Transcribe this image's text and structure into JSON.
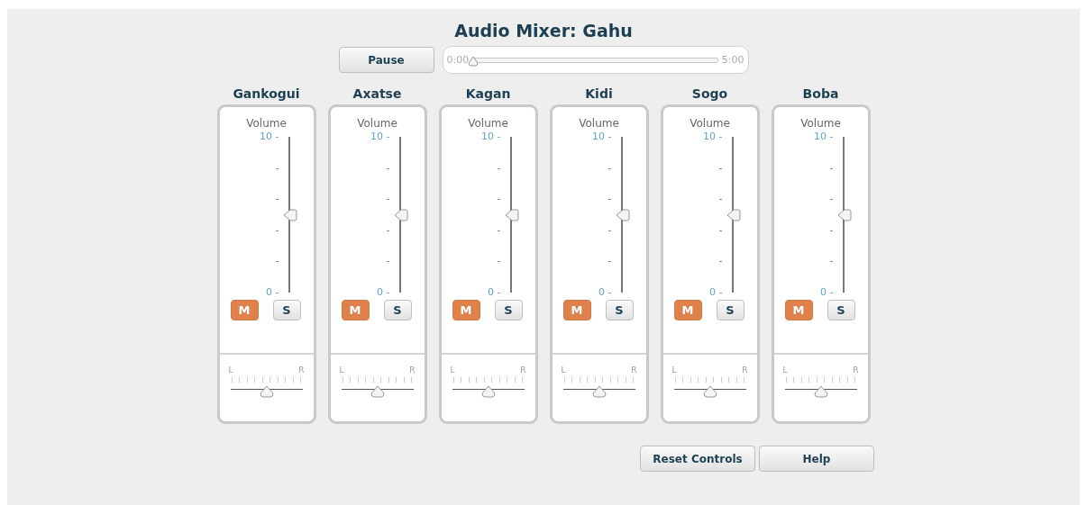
{
  "title": "Audio Mixer: Gahu",
  "transport": {
    "button": "Pause",
    "start": "0:00",
    "end": "5:00",
    "level": 0
  },
  "channels": [
    {
      "name": "Gankogui",
      "volume_label": "Volume",
      "scale": [
        "10 -",
        "-",
        "-",
        "-",
        "-",
        "0 -"
      ],
      "level": 0.5,
      "mute": {
        "label": "M",
        "on": true
      },
      "solo": {
        "label": "S",
        "on": false
      },
      "pan": {
        "left": "L",
        "right": "R",
        "level": 0.5
      }
    },
    {
      "name": "Axatse",
      "volume_label": "Volume",
      "scale": [
        "10 -",
        "-",
        "-",
        "-",
        "-",
        "0 -"
      ],
      "level": 0.5,
      "mute": {
        "label": "M",
        "on": true
      },
      "solo": {
        "label": "S",
        "on": false
      },
      "pan": {
        "left": "L",
        "right": "R",
        "level": 0.5
      }
    },
    {
      "name": "Kagan",
      "volume_label": "Volume",
      "scale": [
        "10 -",
        "-",
        "-",
        "-",
        "-",
        "0 -"
      ],
      "level": 0.5,
      "mute": {
        "label": "M",
        "on": true
      },
      "solo": {
        "label": "S",
        "on": false
      },
      "pan": {
        "left": "L",
        "right": "R",
        "level": 0.5
      }
    },
    {
      "name": "Kidi",
      "volume_label": "Volume",
      "scale": [
        "10 -",
        "-",
        "-",
        "-",
        "-",
        "0 -"
      ],
      "level": 0.5,
      "mute": {
        "label": "M",
        "on": true
      },
      "solo": {
        "label": "S",
        "on": false
      },
      "pan": {
        "left": "L",
        "right": "R",
        "level": 0.5
      }
    },
    {
      "name": "Sogo",
      "volume_label": "Volume",
      "scale": [
        "10 -",
        "-",
        "-",
        "-",
        "-",
        "0 -"
      ],
      "level": 0.5,
      "mute": {
        "label": "M",
        "on": true
      },
      "solo": {
        "label": "S",
        "on": false
      },
      "pan": {
        "left": "L",
        "right": "R",
        "level": 0.5
      }
    },
    {
      "name": "Boba",
      "volume_label": "Volume",
      "scale": [
        "10 -",
        "-",
        "-",
        "-",
        "-",
        "0 -"
      ],
      "level": 0.5,
      "mute": {
        "label": "M",
        "on": true
      },
      "solo": {
        "label": "S",
        "on": false
      },
      "pan": {
        "left": "L",
        "right": "R",
        "level": 0.5
      }
    }
  ],
  "buttons": [
    "Reset Controls",
    "Help"
  ]
}
